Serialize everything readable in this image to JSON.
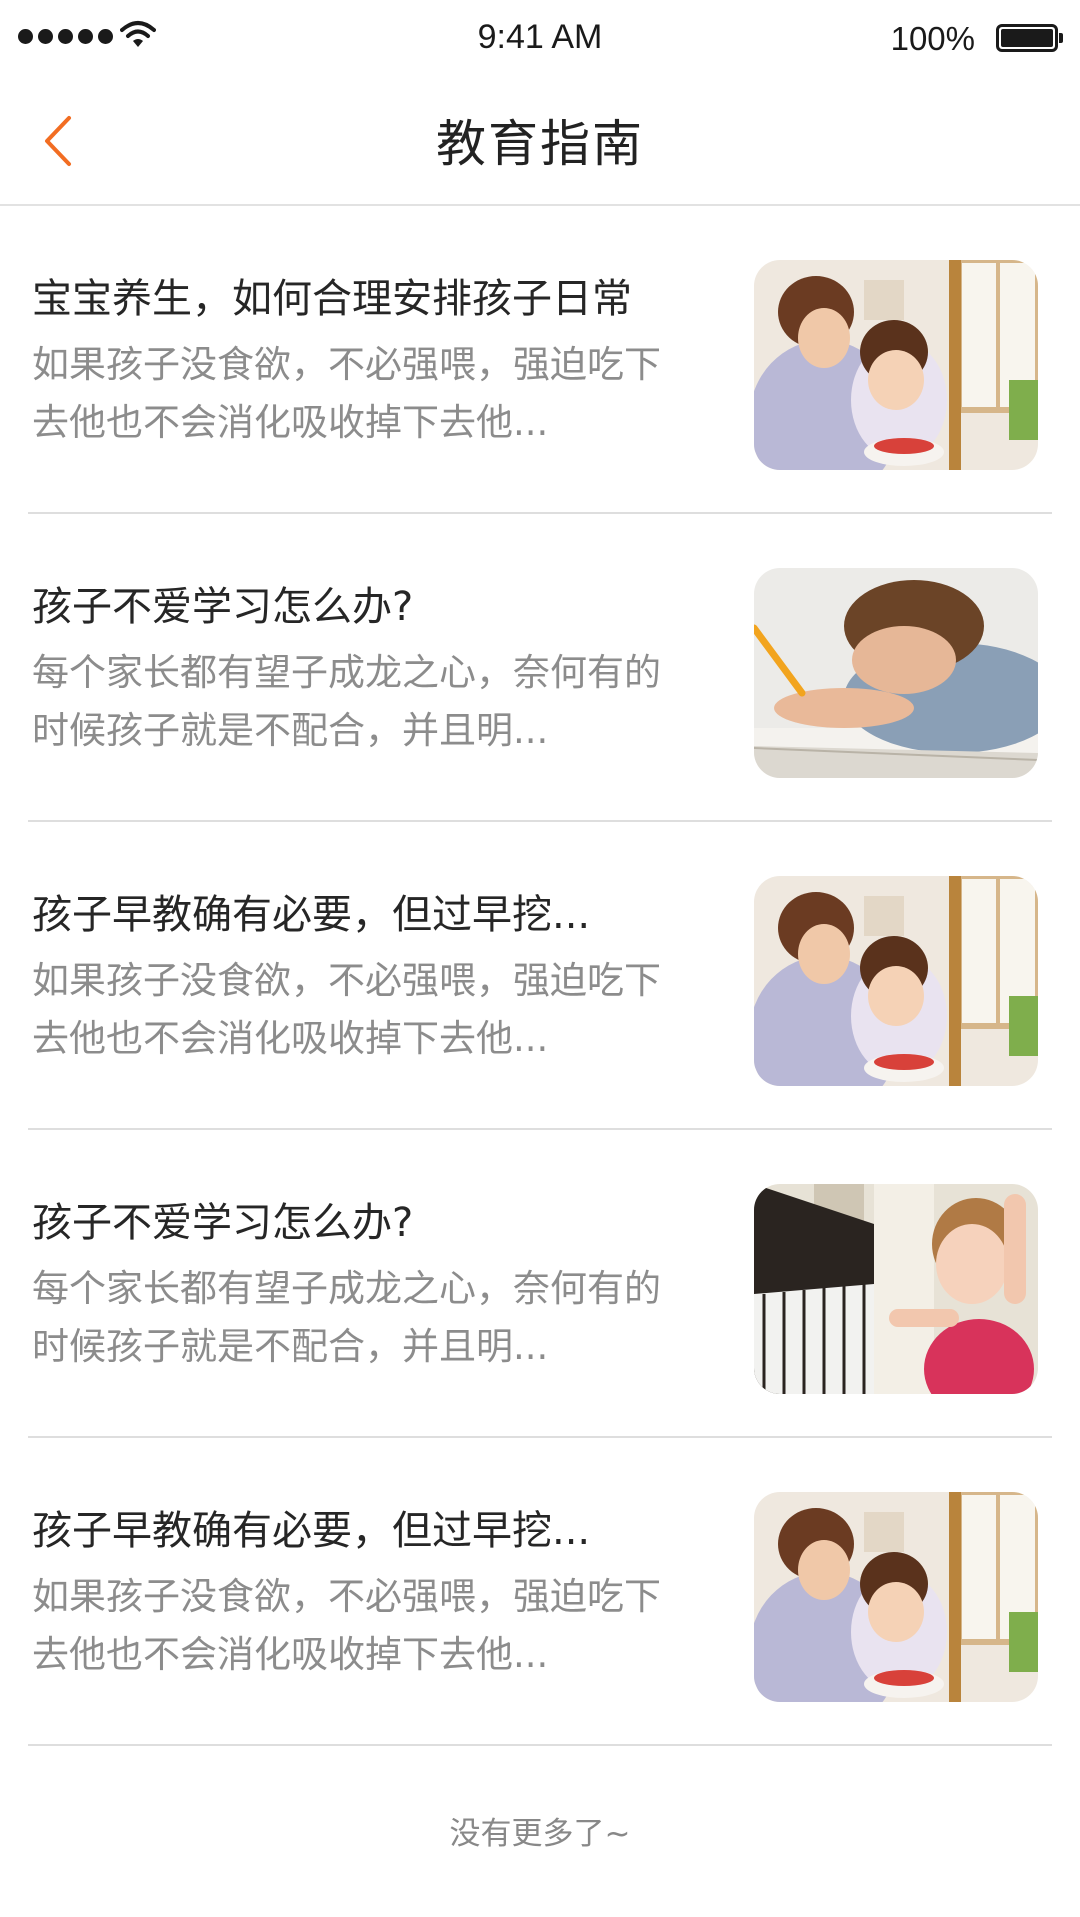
{
  "status_bar": {
    "time": "9:41 AM",
    "battery_percent": "100%"
  },
  "nav": {
    "title": "教育指南",
    "back_icon": "chevron-left-icon",
    "accent_color": "#f26d22"
  },
  "articles": [
    {
      "title": "宝宝养生，如何合理安排孩子日常",
      "summary": "如果孩子没食欲，不必强喂，强迫吃下去他也不会消化吸收掉下去他...",
      "image": "mother-and-daughter-photo"
    },
    {
      "title": "孩子不爱学习怎么办?",
      "summary": "每个家长都有望子成龙之心，奈何有的时候孩子就是不配合，并且明...",
      "image": "boy-writing-homework-photo"
    },
    {
      "title": "孩子早教确有必要，但过早挖...",
      "summary": "如果孩子没食欲，不必强喂，强迫吃下去他也不会消化吸收掉下去他...",
      "image": "mother-and-daughter-photo"
    },
    {
      "title": "孩子不爱学习怎么办?",
      "summary": "每个家长都有望子成龙之心，奈何有的时候孩子就是不配合，并且明...",
      "image": "girl-playing-piano-photo"
    },
    {
      "title": "孩子早教确有必要，但过早挖...",
      "summary": "如果孩子没食欲，不必强喂，强迫吃下去他也不会消化吸收掉下去他...",
      "image": "mother-and-daughter-photo"
    }
  ],
  "footer": {
    "text": "没有更多了~"
  }
}
